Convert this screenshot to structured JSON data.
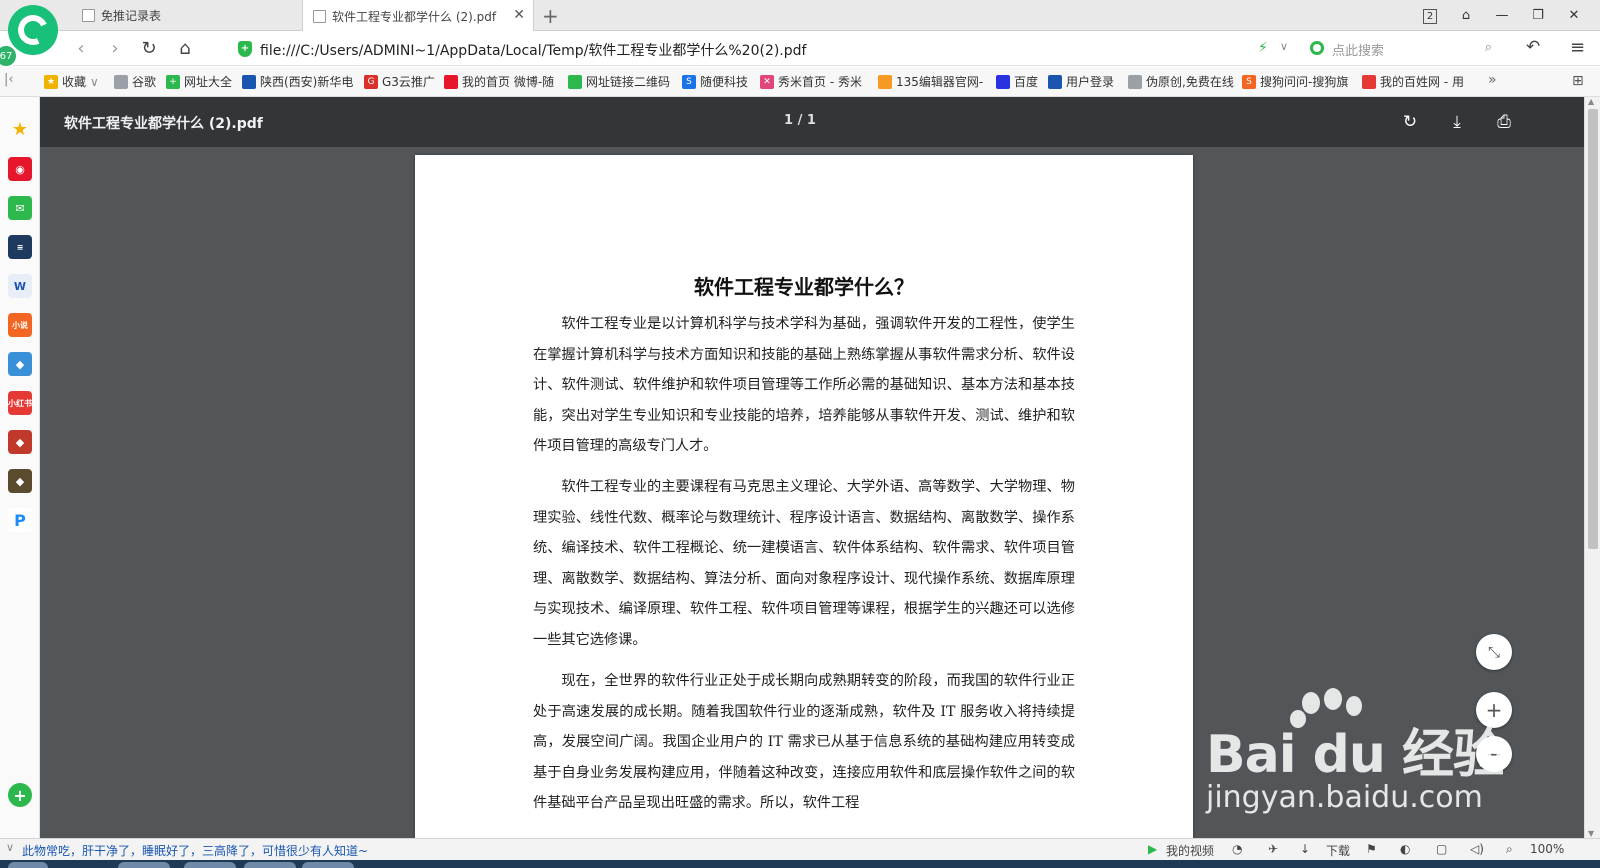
{
  "tabs": {
    "inactive_label": "免推记录表",
    "active_label": "软件工程专业都学什么 (2).pdf",
    "tab_count": "2",
    "badge_count": "67"
  },
  "address": {
    "url": "file:///C:/Users/ADMINI~1/AppData/Local/Temp/软件工程专业都学什么%20(2).pdf",
    "search_placeholder": "点此搜索"
  },
  "bookmarks": [
    {
      "label": "收藏",
      "color": "#f0b400"
    },
    {
      "label": "谷歌",
      "color": "#9aa0a6"
    },
    {
      "label": "网址大全",
      "color": "#2db84d"
    },
    {
      "label": "陕西(西安)新华电",
      "color": "#1a56b0"
    },
    {
      "label": "G3云推广",
      "color": "#d9302c"
    },
    {
      "label": "我的首页 微博-随",
      "color": "#e6162d"
    },
    {
      "label": "网址链接二维码",
      "color": "#2db84d"
    },
    {
      "label": "随便科技",
      "color": "#1a73e8"
    },
    {
      "label": "秀米首页 - 秀米",
      "color": "#e0457b"
    },
    {
      "label": "135编辑器官网-",
      "color": "#f59a23"
    },
    {
      "label": "百度",
      "color": "#2932e1"
    },
    {
      "label": "用户登录",
      "color": "#1a56b0"
    },
    {
      "label": "伪原创,免费在线",
      "color": "#9aa0a6"
    },
    {
      "label": "搜狗问问-搜狗旗",
      "color": "#f26522"
    },
    {
      "label": "我的百姓网 - 用",
      "color": "#e53935"
    }
  ],
  "pdf": {
    "title": "软件工程专业都学什么 (2).pdf",
    "page_indicator": "1 / 1",
    "doc_title": "软件工程专业都学什么？",
    "paragraphs": [
      "软件工程专业是以计算机科学与技术学科为基础，强调软件开发的工程性，使学生在掌握计算机科学与技术方面知识和技能的基础上熟练掌握从事软件需求分析、软件设计、软件测试、软件维护和软件项目管理等工作所必需的基础知识、基本方法和基本技能，突出对学生专业知识和专业技能的培养，培养能够从事软件开发、测试、维护和软件项目管理的高级专门人才。",
      "软件工程专业的主要课程有马克思主义理论、大学外语、高等数学、大学物理、物理实验、线性代数、概率论与数理统计、程序设计语言、数据结构、离散数学、操作系统、编译技术、软件工程概论、统一建模语言、软件体系结构、软件需求、软件项目管理、离散数学、数据结构、算法分析、面向对象程序设计、现代操作系统、数据库原理与实现技术、编译原理、软件工程、软件项目管理等课程，根据学生的兴趣还可以选修一些其它选修课。",
      "现在，全世界的软件行业正处于成长期向成熟期转变的阶段，而我国的软件行业正处于高速发展的成长期。随着我国软件行业的逐渐成熟，软件及 IT 服务收入将持续提高，发展空间广阔。我国企业用户的 IT 需求已从基于信息系统的基础构建应用转变成基于自身业务发展构建应用，伴随着这种改变，连接应用软件和底层操作软件之间的软件基础平台产品呈现出旺盛的需求。所以，软件工程"
    ]
  },
  "watermark": {
    "big": "Bai du 经验",
    "small": "jingyan.baidu.com"
  },
  "status": {
    "news": "此物常吃，肝干净了，睡眠好了，三高降了，可惜很少有人知道~",
    "my_video": "我的视频",
    "download": "下载",
    "zoom": "100%"
  },
  "colors": {
    "pdf_toolbar": "#323639",
    "pdf_background": "#525659",
    "accent_green": "#19c07a"
  }
}
